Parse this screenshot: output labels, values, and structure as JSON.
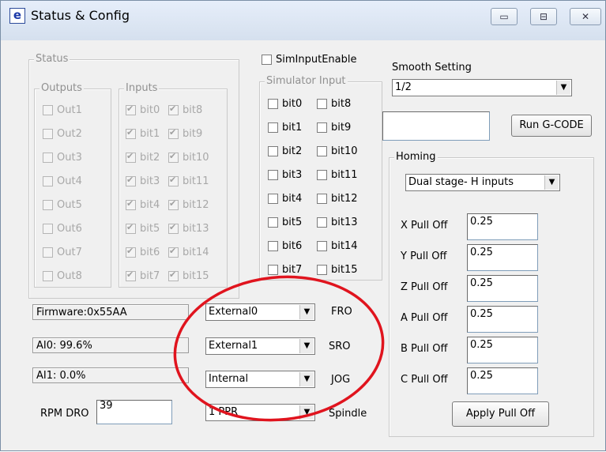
{
  "window": {
    "title": "Status & Config",
    "app_icon_glyph": "e"
  },
  "simulator": {
    "enable_label": "SimInputEnable",
    "group_title": "Simulator Input",
    "bits": [
      "bit0",
      "bit1",
      "bit2",
      "bit3",
      "bit4",
      "bit5",
      "bit6",
      "bit7",
      "bit8",
      "bit9",
      "bit10",
      "bit11",
      "bit12",
      "bit13",
      "bit14",
      "bit15"
    ]
  },
  "status": {
    "group_title": "Status",
    "outputs_title": "Outputs",
    "inputs_title": "Inputs",
    "outputs": [
      "Out1",
      "Out2",
      "Out3",
      "Out4",
      "Out5",
      "Out6",
      "Out7",
      "Out8"
    ],
    "inputs_left": [
      "bit0",
      "bit1",
      "bit2",
      "bit3",
      "bit4",
      "bit5",
      "bit6",
      "bit7"
    ],
    "inputs_right": [
      "bit8",
      "bit9",
      "bit10",
      "bit11",
      "bit12",
      "bit13",
      "bit14",
      "bit15"
    ]
  },
  "smooth": {
    "label": "Smooth Setting",
    "value": "1/2"
  },
  "gcode": {
    "input_value": "",
    "run_label": "Run G-CODE"
  },
  "homing": {
    "group_title": "Homing",
    "mode_value": "Dual stage- H inputs",
    "pulloffs": [
      {
        "label": "X Pull Off",
        "value": "0.25"
      },
      {
        "label": "Y Pull Off",
        "value": "0.25"
      },
      {
        "label": "Z Pull Off",
        "value": "0.25"
      },
      {
        "label": "A Pull Off",
        "value": "0.25"
      },
      {
        "label": "B Pull Off",
        "value": "0.25"
      },
      {
        "label": "C Pull Off",
        "value": "0.25"
      }
    ],
    "apply_label": "Apply Pull Off"
  },
  "readouts": {
    "firmware": "Firmware:0x55AA",
    "ai0": "AI0: 99.6%",
    "ai1": "AI1:  0.0%"
  },
  "rpm": {
    "label": "RPM DRO",
    "value": "39"
  },
  "overrides": {
    "fro": {
      "select": "External0",
      "label": "FRO"
    },
    "sro": {
      "select": "External1",
      "label": "SRO"
    },
    "jog": {
      "select": "Internal",
      "label": "JOG"
    },
    "spindle": {
      "select": "1 PPR",
      "label": "Spindle"
    }
  },
  "annotation_color": "#e0141e"
}
